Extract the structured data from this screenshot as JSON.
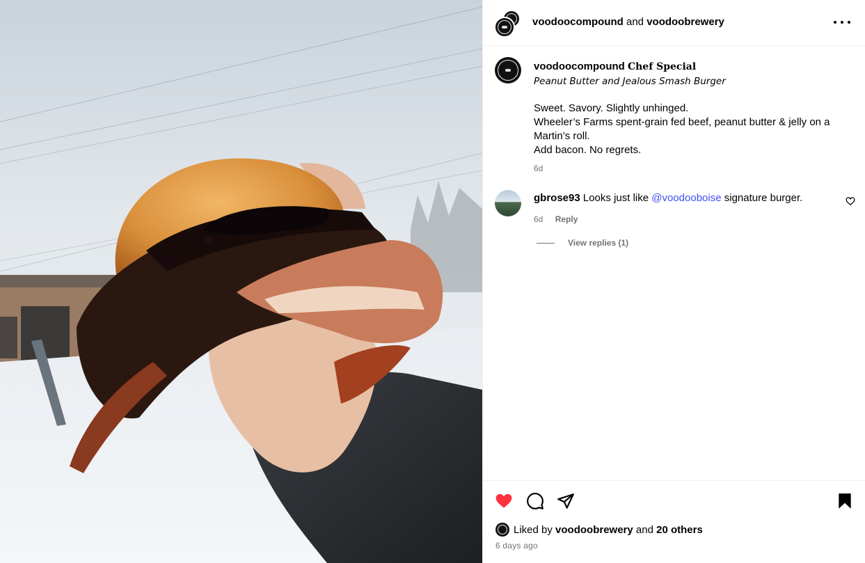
{
  "post": {
    "author": "voodoocompound",
    "connector": "and",
    "collaborator": "voodoobrewery",
    "more_icon": "more-horizontal-icon"
  },
  "caption": {
    "user": "voodoocompound",
    "title": "Chef Special",
    "subtitle": "Peanut Butter and Jealous Smash Burger",
    "lines": [
      "Sweet. Savory. Slightly unhinged.",
      "Wheeler’s Farms spent-grain fed beef, peanut butter & jelly on a",
      "Martin’s roll.",
      "Add bacon. No regrets."
    ],
    "time": "6d"
  },
  "comment": {
    "user": "gbrose93",
    "text_before": "Looks just like",
    "mention": "@voodooboise",
    "text_after": "signature burger.",
    "time": "6d",
    "reply_label": "Reply",
    "view_replies": "View replies (1)"
  },
  "actions": {
    "liked": true,
    "like_color": "#ff3040",
    "icons": [
      "heart-icon",
      "comment-icon",
      "share-icon",
      "bookmark-icon"
    ]
  },
  "likes": {
    "prefix": "Liked by",
    "user": "voodoobrewery",
    "connector": "and",
    "others": "20 others"
  },
  "timestamp": "6 days ago"
}
